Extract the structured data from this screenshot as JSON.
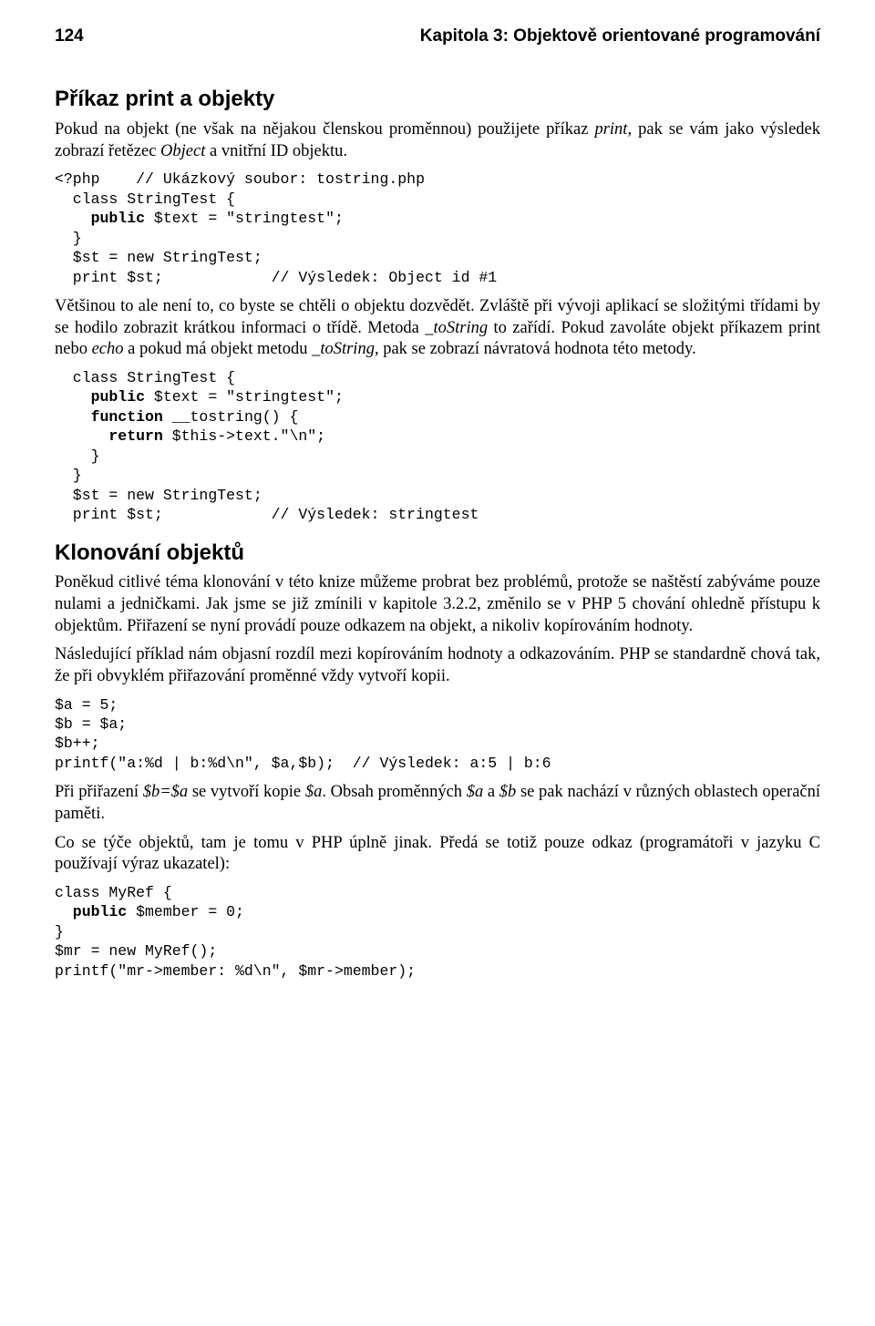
{
  "header": {
    "page_num": "124",
    "chapter": "Kapitola 3: Objektově orientované programování"
  },
  "sections": {
    "print": {
      "title": "Příkaz print a objekty",
      "p1_a": "Pokud na objekt (ne však na nějakou členskou proměnnou) použijete příkaz ",
      "p1_i1": "print",
      "p1_b": ", pak se vám jako výsledek zobrazí řetězec ",
      "p1_i2": "Object",
      "p1_c": " a vnitřní ID objektu.",
      "code1_l1a": "<?php    // Ukázkový soubor: tostring.php",
      "code1_l2a": "  class StringTest {",
      "code1_l3a": "    public",
      "code1_l3b": " $text = \"stringtest\";",
      "code1_l4a": "  }",
      "code1_l5a": "  $st = new StringTest;",
      "code1_l6a": "  print $st;            // Výsledek: Object id #1",
      "p2_a": "Většinou to ale není to, co byste se chtěli o objektu dozvědět. Zvláště při vývoji aplikací se složitými třídami by se hodilo zobrazit krátkou informaci o třídě. Metoda ",
      "p2_i1": "_toString",
      "p2_b": " to zařídí. Pokud zavoláte objekt příkazem print nebo ",
      "p2_i2": "echo",
      "p2_c": " a pokud má objekt metodu ",
      "p2_i3": "_toString",
      "p2_d": ", pak se zobrazí návratová hodnota této metody.",
      "code2_l1": "  class StringTest {",
      "code2_l2a": "    public",
      "code2_l2b": " $text = \"stringtest\";",
      "code2_l3a": "    function",
      "code2_l3b": " __tostring() {",
      "code2_l4a": "      return",
      "code2_l4b": " $this->text.\"\\n\";",
      "code2_l5": "    }",
      "code2_l6": "  }",
      "code2_l7": "  $st = new StringTest;",
      "code2_l8": "  print $st;            // Výsledek: stringtest"
    },
    "clone": {
      "title": "Klonování objektů",
      "p1": "Poněkud citlivé téma klonování v této knize můžeme probrat bez problémů, protože se naštěstí zabýváme pouze nulami a jedničkami. Jak jsme se již zmínili v kapitole 3.2.2, změnilo se v PHP 5 chování ohledně přístupu k objektům. Přiřazení se nyní provádí pouze odkazem na objekt, a nikoliv kopírováním hodnoty.",
      "p2": "Následující příklad nám objasní rozdíl mezi kopírováním hodnoty a odkazováním. PHP se standardně chová tak, že při obvyklém přiřazování proměnné vždy vytvoří kopii.",
      "code1_l1": "$a = 5;",
      "code1_l2": "$b = $a;",
      "code1_l3": "$b++;",
      "code1_l4": "printf(\"a:%d | b:%d\\n\", $a,$b);  // Výsledek: a:5 | b:6",
      "p3_a": "Při přiřazení ",
      "p3_i1": "$b=$a",
      "p3_b": " se vytvoří kopie ",
      "p3_i2": "$a",
      "p3_c": ". Obsah proměnných ",
      "p3_i3": "$a",
      "p3_d": " a ",
      "p3_i4": "$b",
      "p3_e": " se pak nachází v různých oblastech operační paměti.",
      "p4": "Co se týče objektů, tam je tomu v PHP úplně jinak. Předá se totiž pouze odkaz (programátoři v jazyku C používají výraz ukazatel):",
      "code2_l1": "class MyRef {",
      "code2_l2a": "  public",
      "code2_l2b": " $member = 0;",
      "code2_l3": "}",
      "code2_l4": "$mr = new MyRef();",
      "code2_l5": "printf(\"mr->member: %d\\n\", $mr->member);"
    }
  }
}
